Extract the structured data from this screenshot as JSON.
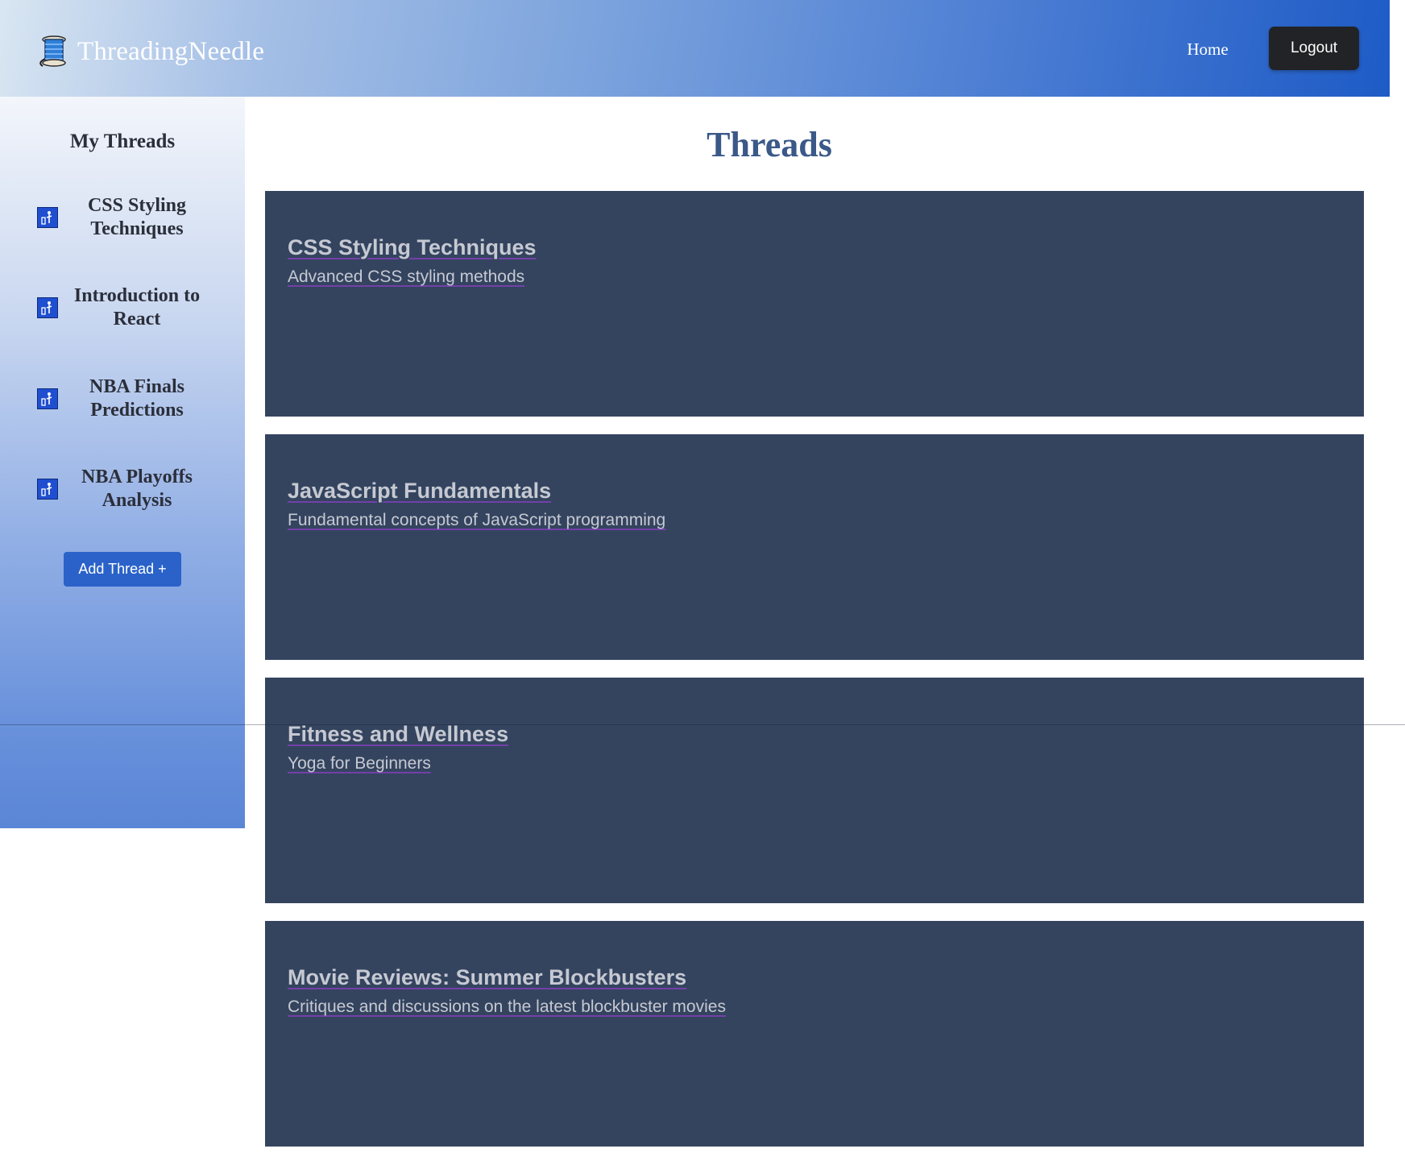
{
  "header": {
    "brand": "ThreadingNeedle",
    "brand_icon": "spool-of-thread-icon",
    "nav_home": "Home",
    "logout_label": "Logout"
  },
  "sidebar": {
    "title": "My Threads",
    "items": [
      {
        "label": "CSS Styling Techniques",
        "icon": "thread-icon"
      },
      {
        "label": "Introduction to React",
        "icon": "thread-icon"
      },
      {
        "label": "NBA Finals Predictions",
        "icon": "thread-icon"
      },
      {
        "label": "NBA Playoffs Analysis",
        "icon": "thread-icon"
      }
    ],
    "add_button": "Add Thread +"
  },
  "main": {
    "title": "Threads",
    "threads": [
      {
        "title": "CSS Styling Techniques",
        "description": "Advanced CSS styling methods"
      },
      {
        "title": "JavaScript Fundamentals",
        "description": "Fundamental concepts of JavaScript programming"
      },
      {
        "title": "Fitness and Wellness",
        "description": "Yoga for Beginners"
      },
      {
        "title": "Movie Reviews: Summer Blockbusters",
        "description": "Critiques and discussions on the latest blockbuster movies"
      }
    ]
  },
  "colors": {
    "card_bg": "#34445f",
    "logout_bg": "#222326",
    "add_button_bg": "#2a62c9",
    "title_color": "#3a5888"
  }
}
